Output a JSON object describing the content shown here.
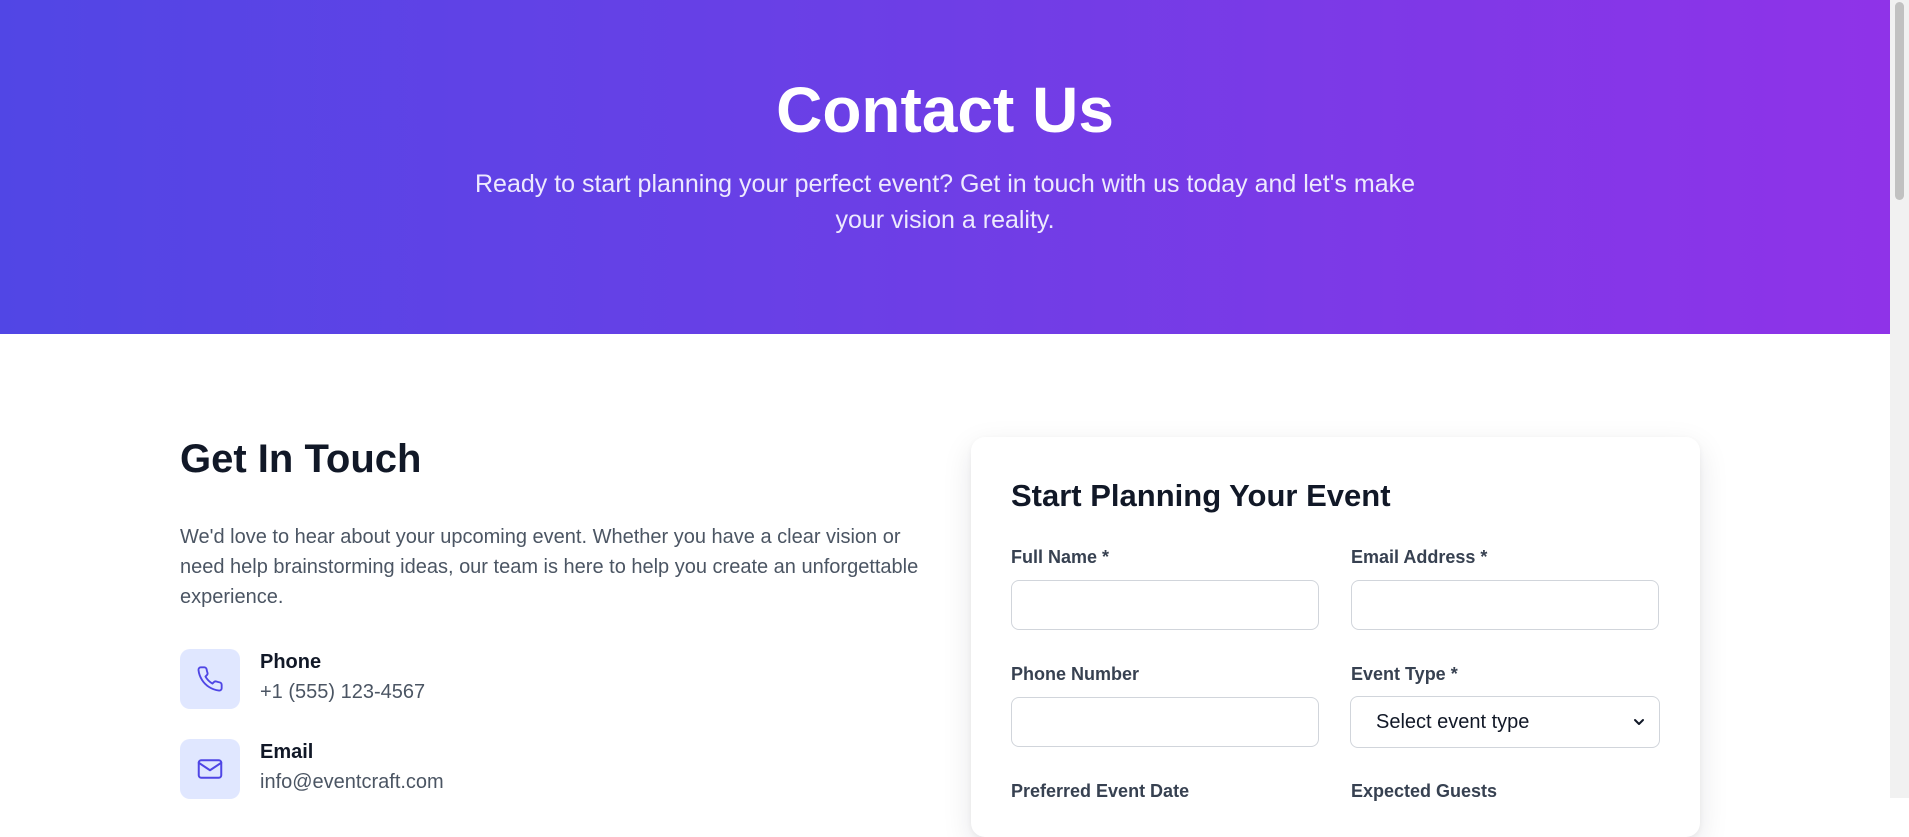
{
  "hero": {
    "title": "Contact Us",
    "subtitle": "Ready to start planning your perfect event? Get in touch with us today and let's make your vision a reality."
  },
  "info": {
    "heading": "Get In Touch",
    "intro": "We'd love to hear about your upcoming event. Whether you have a clear vision or need help brainstorming ideas, our team is here to help you create an unforgettable experience.",
    "items": [
      {
        "icon": "phone-icon",
        "label": "Phone",
        "value": "+1 (555) 123-4567"
      },
      {
        "icon": "mail-icon",
        "label": "Email",
        "value": "info@eventcraft.com"
      }
    ]
  },
  "form": {
    "title": "Start Planning Your Event",
    "full_name_label": "Full Name *",
    "full_name_value": "",
    "email_label": "Email Address *",
    "email_value": "",
    "phone_label": "Phone Number",
    "phone_value": "",
    "event_type_label": "Event Type *",
    "event_type_selected": "Select event type",
    "date_label": "Preferred Event Date",
    "guests_label": "Expected Guests"
  },
  "colors": {
    "hero_gradient_start": "#5146e5",
    "hero_gradient_end": "#8f33e8",
    "icon_box_bg": "#e0e7ff",
    "icon_stroke": "#4f46e5"
  }
}
